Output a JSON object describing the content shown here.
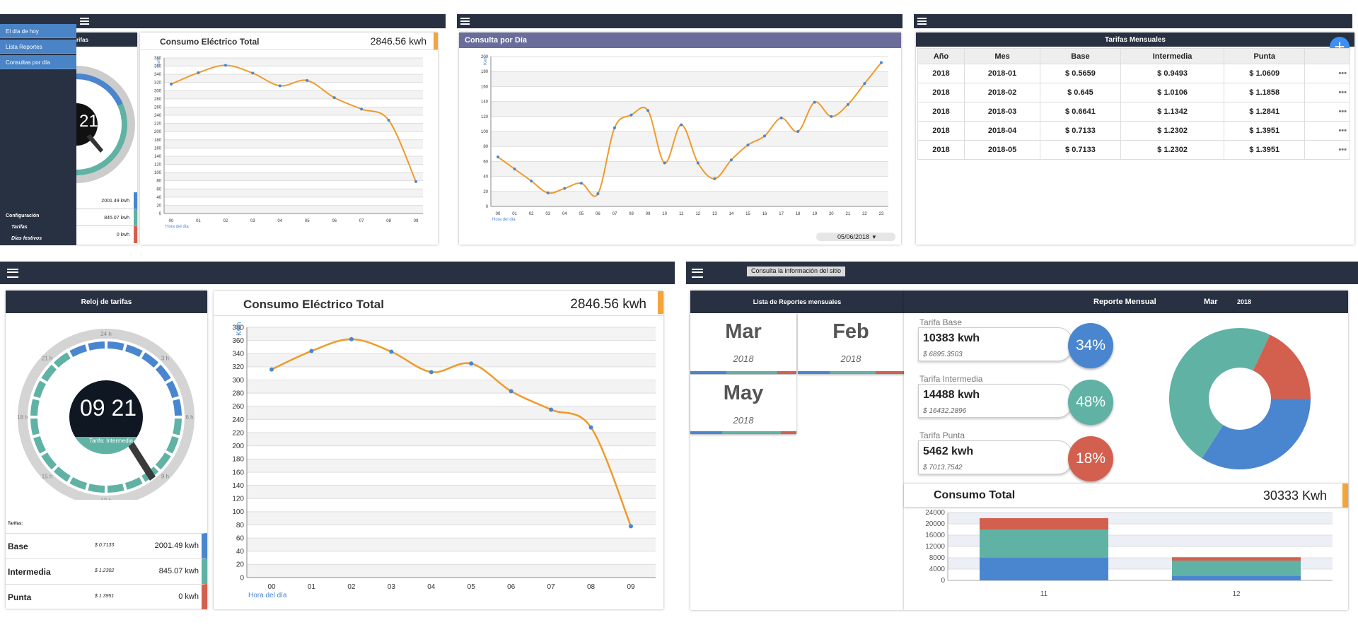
{
  "menu": {
    "items": [
      "El día de hoy",
      "Lista Reportes",
      "Consultas por día"
    ],
    "config_title": "Configuración",
    "config_items": [
      "Tarifas",
      "Días festivos"
    ]
  },
  "small_clock": {
    "header_fragment": "rifas",
    "time_fragment": "21",
    "rows": [
      {
        "value": "2001.49 kwh"
      },
      {
        "value": "845.07 kwh"
      },
      {
        "value": "0 kwh"
      }
    ]
  },
  "consumo_small": {
    "title": "Consumo Eléctrico Total",
    "total": "2846.56 kwh"
  },
  "consulta": {
    "title": "Consulta por Día",
    "date": "05/06/2018",
    "unit": "Kwh",
    "xlabel": "Hora del día"
  },
  "tarifas": {
    "title": "Tarifas Mensuales",
    "add_label": "+",
    "more_label": "•••",
    "columns": [
      "Año",
      "Mes",
      "Base",
      "Intermedia",
      "Punta"
    ],
    "rows": [
      [
        "2018",
        "2018-01",
        "$ 0.5659",
        "$ 0.9493",
        "$ 1.0609"
      ],
      [
        "2018",
        "2018-02",
        "$ 0.645",
        "$ 1.0106",
        "$ 1.1858"
      ],
      [
        "2018",
        "2018-03",
        "$ 0.6641",
        "$ 1.1342",
        "$ 1.2841"
      ],
      [
        "2018",
        "2018-04",
        "$ 0.7133",
        "$ 1.2302",
        "$ 1.3951"
      ],
      [
        "2018",
        "2018-05",
        "$ 0.7133",
        "$ 1.2302",
        "$ 1.3951"
      ]
    ]
  },
  "reloj": {
    "title": "Reloj de tarifas",
    "time": "09 21",
    "current_tarifa": "Tarifa: Intermedia",
    "hour_labels": [
      "24 h",
      "3 h",
      "6 h",
      "9 h",
      "12 h",
      "15 h",
      "18 h",
      "21 h"
    ],
    "tarifas_label": "Tarifas:",
    "rows": [
      {
        "name": "Base",
        "price": "$ 0.7133",
        "value": "2001.49 kwh"
      },
      {
        "name": "Intermedia",
        "price": "$ 1.2302",
        "value": "845.07 kwh"
      },
      {
        "name": "Punta",
        "price": "$ 1.3951",
        "value": "0 kwh"
      }
    ]
  },
  "consumo": {
    "title": "Consumo Eléctrico Total",
    "total": "2846.56 kwh",
    "unit": "Kwh",
    "xlabel": "Hora del día"
  },
  "site_info_button": "Consulta la información del sitio",
  "reportes": {
    "title": "Lista de Reportes mensuales",
    "months": [
      {
        "m": "Mar",
        "y": "2018"
      },
      {
        "m": "Feb",
        "y": "2018"
      },
      {
        "m": "May",
        "y": "2018"
      }
    ]
  },
  "reporte": {
    "title": "Reporte Mensual",
    "month": "Mar",
    "year": "2018",
    "tarifas": [
      {
        "name": "Tarifa Base",
        "kwh": "10383 kwh",
        "cost": "$ 6895.3503",
        "pct": "34%"
      },
      {
        "name": "Tarifa Intermedia",
        "kwh": "14488 kwh",
        "cost": "$ 16432.2896",
        "pct": "48%"
      },
      {
        "name": "Tarifa Punta",
        "kwh": "5462 kwh",
        "cost": "$ 7013.7542",
        "pct": "18%"
      }
    ],
    "total_label": "Consumo Total",
    "total": "30333 Kwh"
  },
  "colors": {
    "base": "#4a86cf",
    "intermedia": "#5fb2a4",
    "punta": "#d3604f",
    "line": "#f09a2a",
    "accent": "#f3a43b",
    "navy": "#283141"
  },
  "chart_data": [
    {
      "id": "consumo-small",
      "type": "line",
      "categories": [
        "00",
        "01",
        "02",
        "03",
        "04",
        "05",
        "06",
        "07",
        "08",
        "09"
      ],
      "values": [
        316,
        344,
        362,
        343,
        312,
        325,
        283,
        255,
        228,
        78
      ],
      "ylim": [
        0,
        380
      ],
      "ylabel": "Kwh",
      "xlabel": "Hora del día"
    },
    {
      "id": "consulta",
      "type": "line",
      "categories": [
        "00",
        "01",
        "02",
        "03",
        "04",
        "05",
        "06",
        "07",
        "08",
        "09",
        "10",
        "11",
        "12",
        "13",
        "14",
        "15",
        "16",
        "17",
        "18",
        "19",
        "20",
        "21",
        "22",
        "23"
      ],
      "values": [
        66,
        50,
        34,
        18,
        24,
        31,
        17,
        105,
        122,
        128,
        58,
        109,
        58,
        37,
        62,
        82,
        94,
        118,
        100,
        139,
        120,
        136,
        164,
        192
      ],
      "ylim": [
        0,
        200
      ],
      "ylabel": "Kwh",
      "xlabel": "Hora del día"
    },
    {
      "id": "consumo",
      "type": "line",
      "categories": [
        "00",
        "01",
        "02",
        "03",
        "04",
        "05",
        "06",
        "07",
        "08",
        "09"
      ],
      "values": [
        316,
        344,
        362,
        343,
        312,
        325,
        283,
        255,
        228,
        78
      ],
      "ylim": [
        0,
        380
      ],
      "ylabel": "Kwh",
      "xlabel": "Hora del día"
    },
    {
      "id": "donut",
      "type": "pie",
      "labels": [
        "Tarifa Base",
        "Tarifa Intermedia",
        "Tarifa Punta"
      ],
      "values": [
        34,
        48,
        18
      ]
    },
    {
      "id": "monthly-bars",
      "type": "bar",
      "categories": [
        "11",
        "12"
      ],
      "ylim": [
        0,
        24000
      ],
      "series": [
        {
          "name": "Base",
          "values": [
            8000,
            1500
          ]
        },
        {
          "name": "Intermedia",
          "values": [
            10000,
            5500
          ]
        },
        {
          "name": "Punta",
          "values": [
            4000,
            1200
          ]
        }
      ]
    }
  ]
}
